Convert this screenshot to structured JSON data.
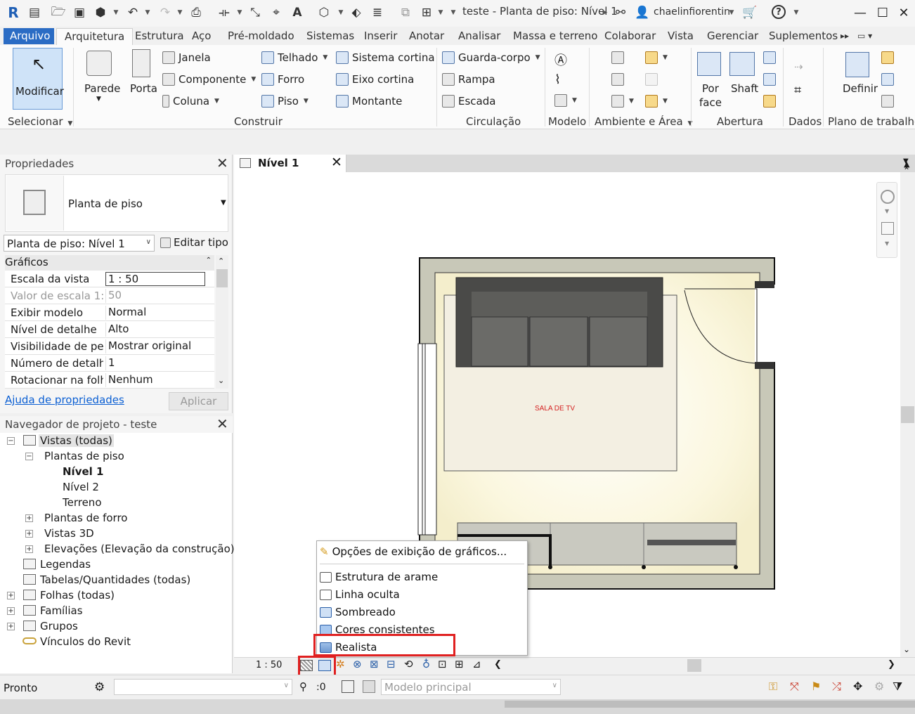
{
  "window": {
    "title": "teste - Planta de piso: Nível 1",
    "user": "chaelinfiorentin"
  },
  "tabs": [
    "Arquivo",
    "Arquitetura",
    "Estrutura",
    "Aço",
    "Pré-moldado",
    "Sistemas",
    "Inserir",
    "Anotar",
    "Analisar",
    "Massa e terreno",
    "Colaborar",
    "Vista",
    "Gerenciar",
    "Suplementos"
  ],
  "ribbon": {
    "modificar": "Modificar",
    "parede": "Parede",
    "porta": "Porta",
    "janela": "Janela",
    "componente": "Componente",
    "coluna": "Coluna",
    "telhado": "Telhado",
    "forro": "Forro",
    "piso": "Piso",
    "sistema_cortina": "Sistema  cortina",
    "eixo_cortina": "Eixo  cortina",
    "montante": "Montante",
    "guarda_corpo": "Guarda-corpo",
    "rampa": "Rampa",
    "escada": "Escada",
    "por_face_1": "Por",
    "por_face_2": "face",
    "shaft": "Shaft",
    "definir": "Definir",
    "panels": {
      "selecionar": "Selecionar",
      "construir": "Construir",
      "circulacao": "Circulação",
      "modelo": "Modelo",
      "ambiente": "Ambiente e Área",
      "abertura": "Abertura",
      "dados": "Dados",
      "plano": "Plano de trabalho"
    }
  },
  "properties": {
    "title": "Propriedades",
    "type_name": "Planta de piso",
    "selector": "Planta de piso: Nível 1",
    "edit_type": "Editar tipo",
    "section": "Gráficos",
    "rows": [
      {
        "key": "Escala da vista",
        "value": "1 : 50"
      },
      {
        "key": "Valor de escala    1:",
        "value": "50"
      },
      {
        "key": "Exibir modelo",
        "value": "Normal"
      },
      {
        "key": "Nível de detalhe",
        "value": "Alto"
      },
      {
        "key": "Visibilidade de pe...",
        "value": "Mostrar original"
      },
      {
        "key": "Número de detalhe",
        "value": "1"
      },
      {
        "key": "Rotacionar na folha",
        "value": "Nenhum"
      }
    ],
    "help_link": "Ajuda de propriedades",
    "apply": "Aplicar"
  },
  "navigator": {
    "title": "Navegador de projeto - teste",
    "items": {
      "vistas": "Vistas (todas)",
      "plantas_piso": "Plantas de piso",
      "nivel1": "Nível 1",
      "nivel2": "Nível 2",
      "terreno": "Terreno",
      "plantas_forro": "Plantas de forro",
      "vistas3d": "Vistas 3D",
      "elevacoes": "Elevações (Elevação da construção)",
      "legendas": "Legendas",
      "tabelas": "Tabelas/Quantidades (todas)",
      "folhas": "Folhas (todas)",
      "familias": "Famílias",
      "grupos": "Grupos",
      "vinculos": "Vínculos do Revit"
    }
  },
  "view": {
    "tab": "Nível 1",
    "room_label": "SALA DE TV",
    "scale": "1 : 50"
  },
  "popup": {
    "options": "Opções de exibição de gráficos...",
    "items": [
      "Estrutura de arame",
      "Linha oculta",
      "Sombreado",
      "Cores consistentes",
      "Realista"
    ]
  },
  "status": {
    "ready": "Pronto",
    "count": ":0",
    "model": "Modelo principal"
  },
  "colors": {
    "accent": "#2b6cc4",
    "highlight": "#e02020",
    "wall": "#c8c8b8",
    "floor": "#fbf7dc",
    "sofa": "#4a4a48"
  }
}
